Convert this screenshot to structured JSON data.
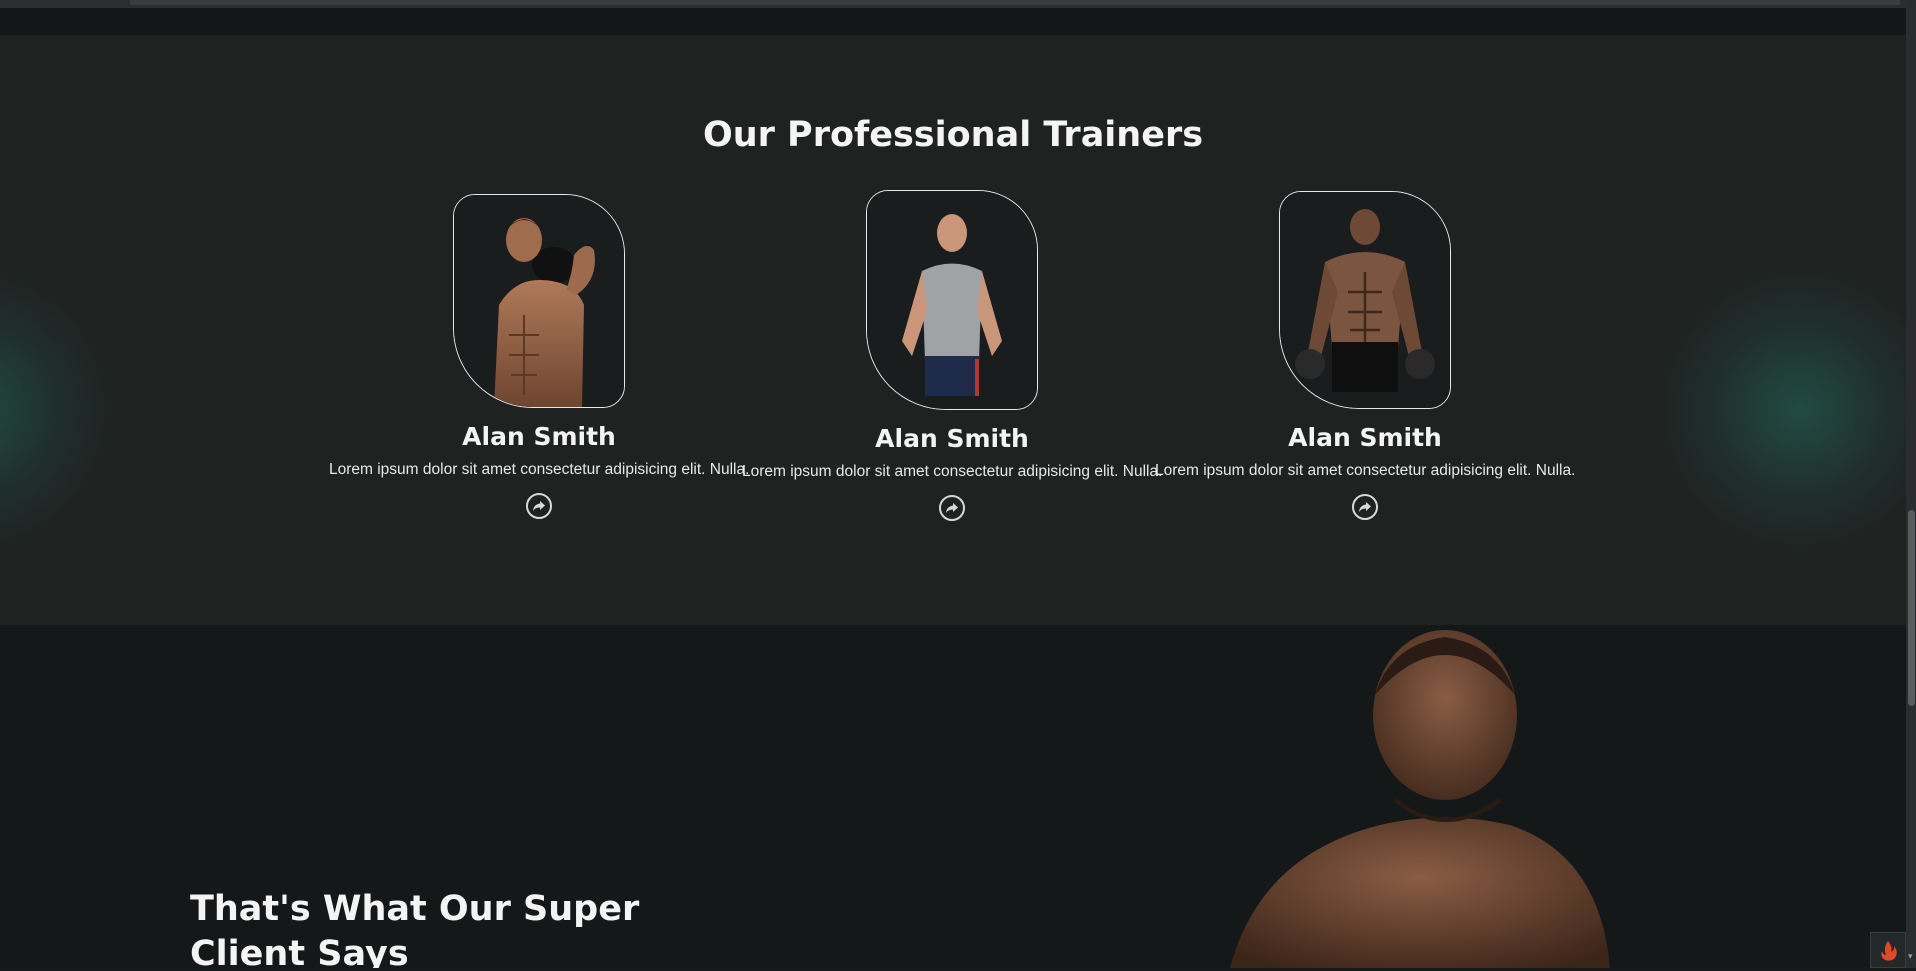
{
  "trainers_section": {
    "title": "Our Professional Trainers",
    "cards": [
      {
        "name": "Alan Smith",
        "description": "Lorem ipsum dolor sit amet consectetur adipisicing elit. Nulla.",
        "share_icon": "share-arrow-icon"
      },
      {
        "name": "Alan Smith",
        "description": "Lorem ipsum dolor sit amet consectetur adipisicing elit. Nulla.",
        "share_icon": "share-arrow-icon"
      },
      {
        "name": "Alan Smith",
        "description": "Lorem ipsum dolor sit amet consectetur adipisicing elit. Nulla.",
        "share_icon": "share-arrow-icon"
      }
    ]
  },
  "testimonials_section": {
    "title": "That's What Our Super Client Says"
  },
  "colors": {
    "page_bg": "#171a1a",
    "section_bg": "#1f2221",
    "accent_glow": "#226e5f",
    "text": "#f4f4f4"
  }
}
